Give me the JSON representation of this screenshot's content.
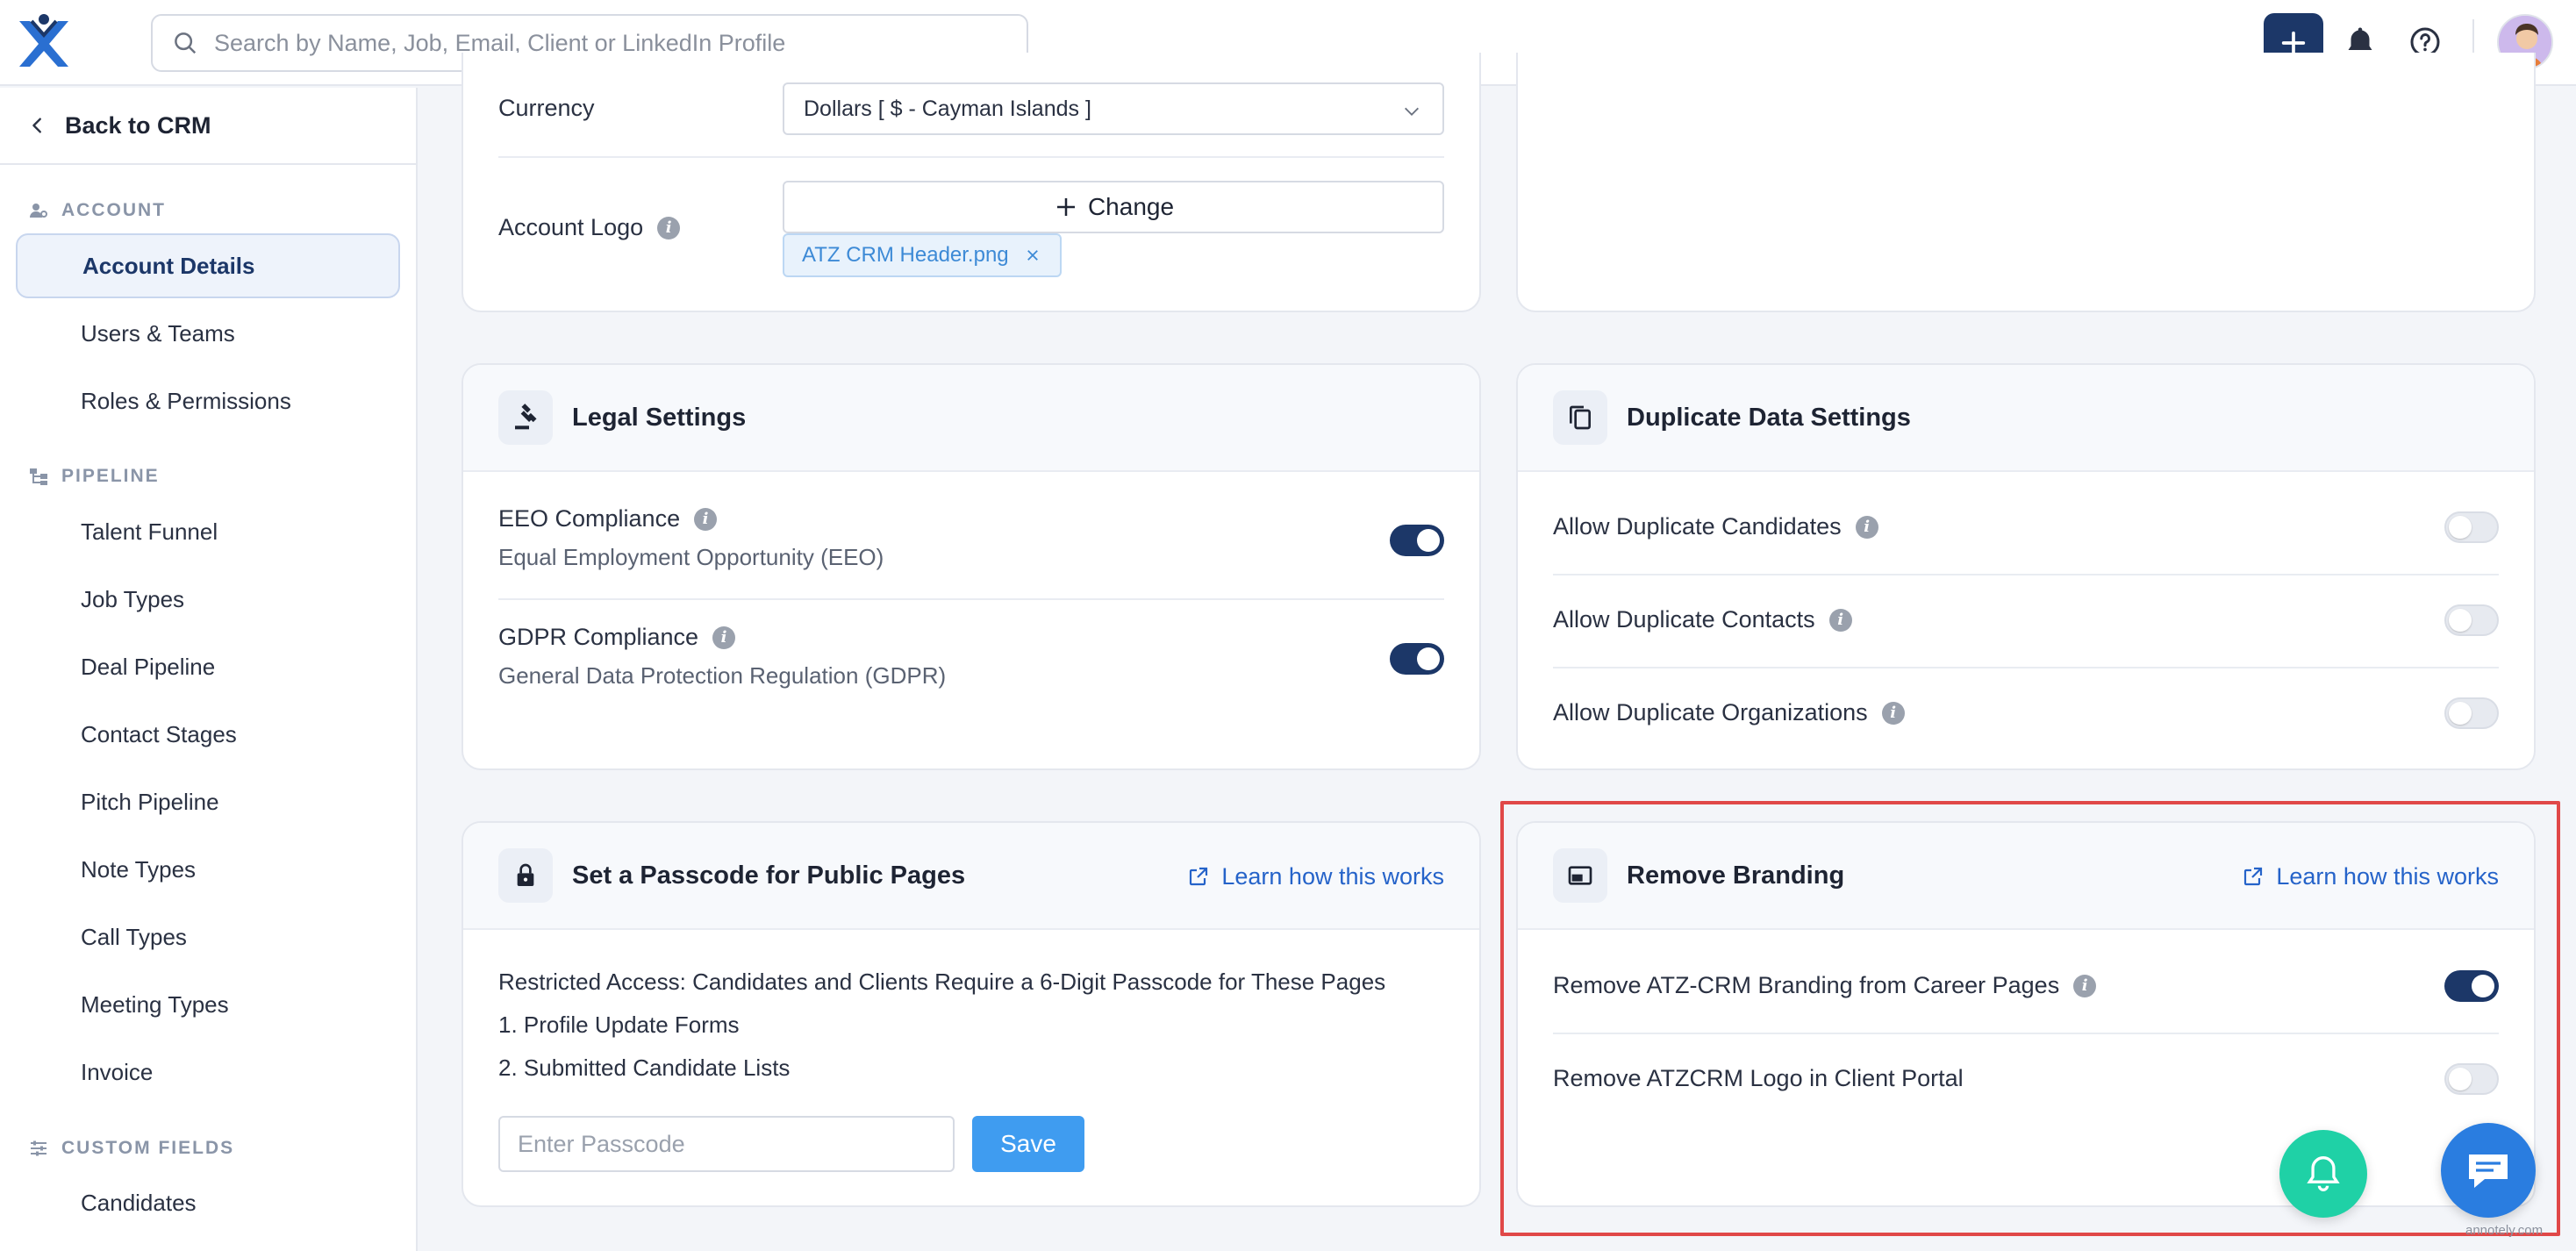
{
  "search": {
    "placeholder": "Search by Name, Job, Email, Client or LinkedIn Profile"
  },
  "sidebar": {
    "back_label": "Back to CRM",
    "sections": [
      {
        "label": "ACCOUNT",
        "icon": "account-icon"
      },
      {
        "label": "PIPELINE",
        "icon": "pipeline-icon"
      },
      {
        "label": "CUSTOM FIELDS",
        "icon": "sliders-icon"
      }
    ],
    "account_items": [
      "Account Details",
      "Users & Teams",
      "Roles & Permissions"
    ],
    "pipeline_items": [
      "Talent Funnel",
      "Job Types",
      "Deal Pipeline",
      "Contact Stages",
      "Pitch Pipeline",
      "Note Types",
      "Call Types",
      "Meeting Types",
      "Invoice"
    ],
    "custom_field_items": [
      "Candidates"
    ],
    "active_item": "Account Details"
  },
  "account_card": {
    "currency_label": "Currency",
    "currency_value": "Dollars [ $ - Cayman Islands ]",
    "logo_label": "Account Logo",
    "change_label": "Change",
    "file_name": "ATZ CRM Header.png"
  },
  "legal": {
    "title": "Legal Settings",
    "items": [
      {
        "label": "EEO Compliance",
        "sub": "Equal Employment Opportunity (EEO)",
        "enabled": true
      },
      {
        "label": "GDPR Compliance",
        "sub": "General Data Protection Regulation (GDPR)",
        "enabled": true
      }
    ]
  },
  "duplicate": {
    "title": "Duplicate Data Settings",
    "items": [
      {
        "label": "Allow Duplicate Candidates",
        "enabled": false
      },
      {
        "label": "Allow Duplicate Contacts",
        "enabled": false
      },
      {
        "label": "Allow Duplicate Organizations",
        "enabled": false
      }
    ]
  },
  "passcode": {
    "title": "Set a Passcode for Public Pages",
    "learn_label": "Learn how this works",
    "description": "Restricted Access: Candidates and Clients Require a 6-Digit Passcode for These Pages",
    "list": [
      "1. Profile Update Forms",
      "2. Submitted Candidate Lists"
    ],
    "input_placeholder": "Enter Passcode",
    "save_label": "Save"
  },
  "branding": {
    "title": "Remove Branding",
    "learn_label": "Learn how this works",
    "items": [
      {
        "label": "Remove ATZ-CRM Branding from Career Pages",
        "enabled": true
      },
      {
        "label": "Remove ATZCRM Logo in Client Portal",
        "enabled": false
      }
    ]
  },
  "watermark": "annotely.com",
  "colors": {
    "primary": "#1c3768",
    "link": "#2563c9",
    "save": "#3f9cf0",
    "highlight": "#e04848",
    "fab_bell": "#1fd1a6",
    "fab_chat": "#2a7de0"
  }
}
